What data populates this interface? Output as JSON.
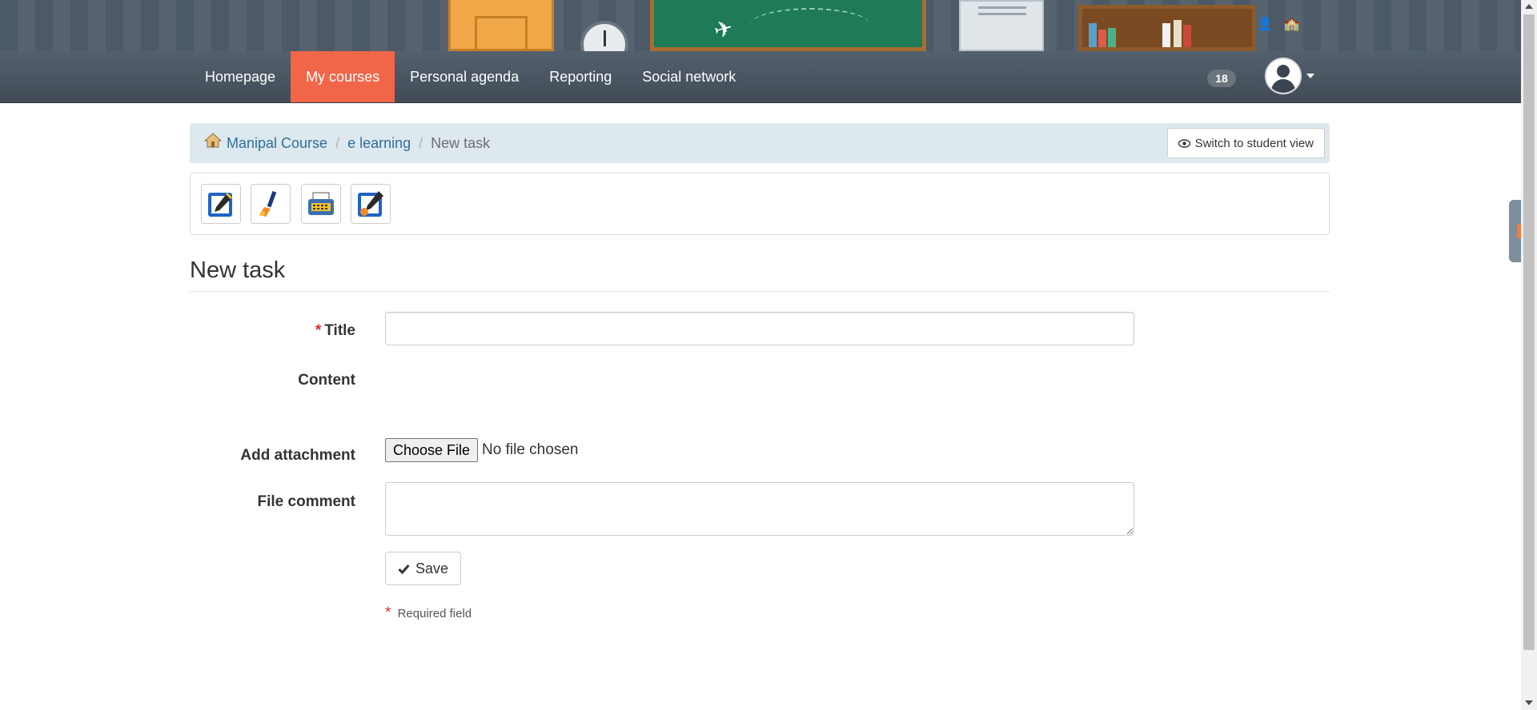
{
  "nav": {
    "items": [
      {
        "label": "Homepage",
        "active": false
      },
      {
        "label": "My courses",
        "active": true
      },
      {
        "label": "Personal agenda",
        "active": false
      },
      {
        "label": "Reporting",
        "active": false
      },
      {
        "label": "Social network",
        "active": false
      }
    ],
    "notification_count": "18",
    "active_color": "#f16649"
  },
  "breadcrumb": {
    "items": [
      "Manipal Course",
      "e learning"
    ],
    "current": "New task",
    "switch_view_label": "Switch to student view"
  },
  "toolbar": {
    "icons": [
      "edit-task-icon",
      "paintbrush-icon",
      "typewriter-icon",
      "edit-settings-icon"
    ]
  },
  "form": {
    "page_title": "New task",
    "title_label": "Title",
    "title_value": "",
    "content_label": "Content",
    "attachment_label": "Add attachment",
    "choose_file_label": "Choose File",
    "no_file_text": "No file chosen",
    "file_comment_label": "File comment",
    "file_comment_value": "",
    "save_label": "Save",
    "required_star": "*",
    "required_note": "Required field"
  }
}
